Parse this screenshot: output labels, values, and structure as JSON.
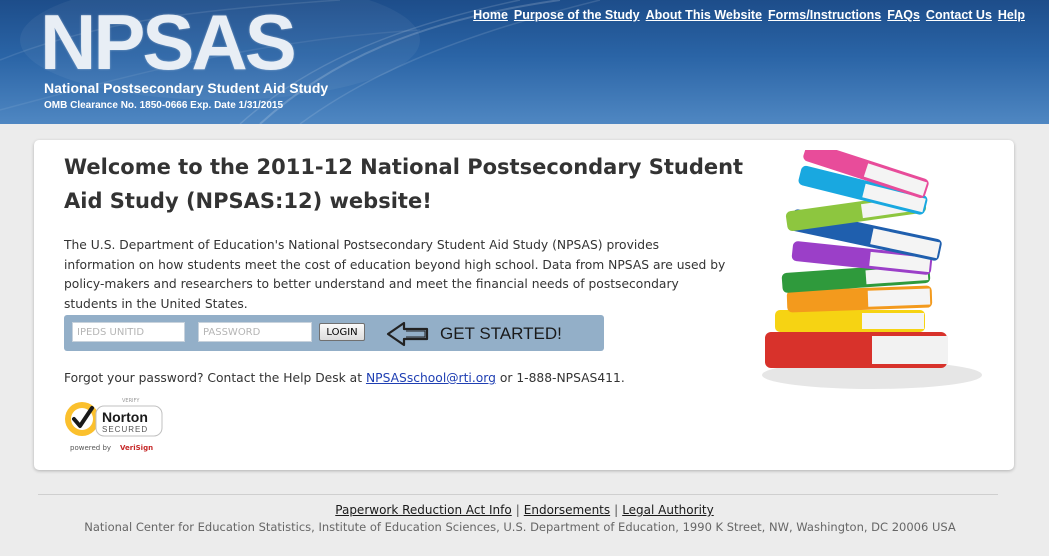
{
  "header": {
    "logo": "NPSAS",
    "subtitle": "National Postsecondary Student Aid Study",
    "omb": "OMB Clearance No. 1850-0666   Exp. Date 1/31/2015",
    "nav": [
      "Home",
      "Purpose of the Study",
      "About This Website",
      "Forms/Instructions",
      "FAQs",
      "Contact Us",
      "Help"
    ]
  },
  "main": {
    "title": "Welcome to the 2011-12 National Postsecondary Student Aid Study (NPSAS:12) website!",
    "intro": "The U.S. Department of Education's National Postsecondary Student Aid Study (NPSAS) provides information on how students meet the cost of education beyond high school. Data from NPSAS are used by policy-makers and researchers to better understand and meet the financial needs of postsecondary students in the United States.",
    "login": {
      "unitid_placeholder": "IPEDS UNITID",
      "password_placeholder": "PASSWORD",
      "login_label": "LOGIN",
      "get_started": "GET STARTED!"
    },
    "forgot": {
      "prefix": "Forgot your password? Contact the Help Desk at ",
      "email": "NPSASschool@rti.org",
      "suffix": " or 1-888-NPSAS411."
    },
    "norton": {
      "verify": "VERIFY",
      "brand": "Norton",
      "secured": "SECURED",
      "powered_by": "powered by",
      "verisign": "VeriSign"
    }
  },
  "footer": {
    "links": [
      "Paperwork Reduction Act Info",
      "Endorsements",
      "Legal Authority"
    ],
    "separator": "|",
    "address": "National Center for Education Statistics, Institute of Education Sciences, U.S. Department of Education, 1990 K Street, NW, Washington, DC 20006 USA"
  },
  "colors": {
    "header_top": "#1d4d8a",
    "header_bottom": "#4f87c2",
    "login_bar": "#93afc8",
    "link": "#1f3fb3"
  }
}
